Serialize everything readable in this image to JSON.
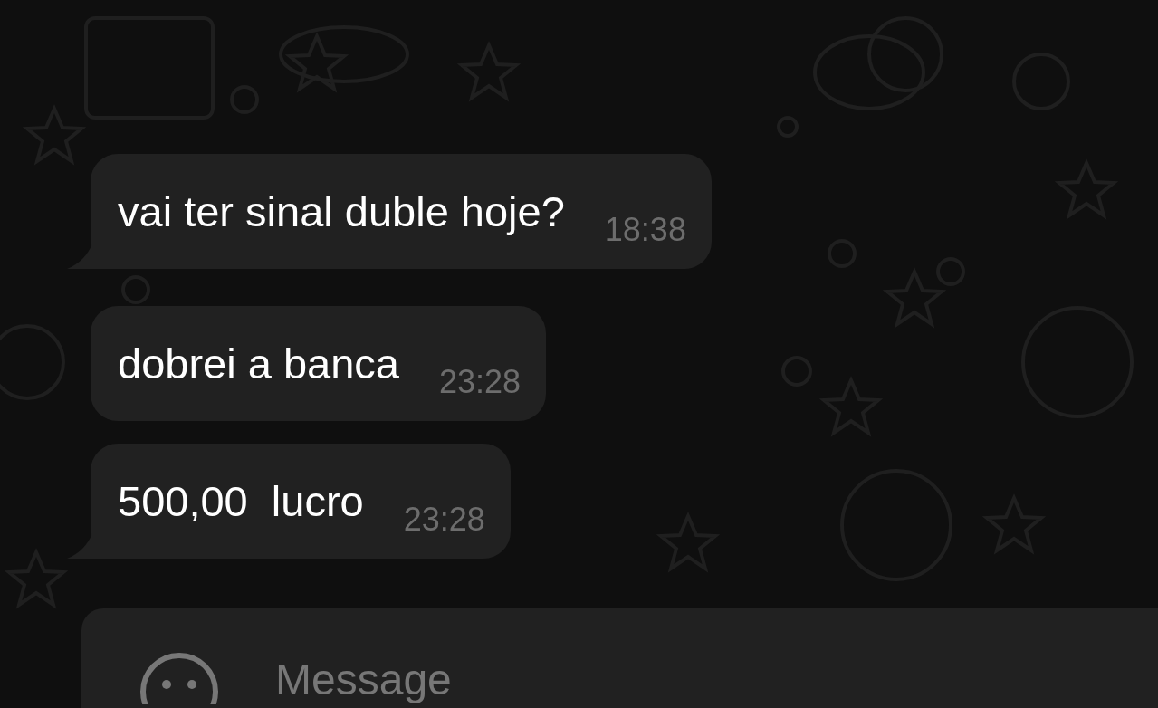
{
  "messages": [
    {
      "text": "vai ter sinal duble hoje?",
      "time": "18:38",
      "tail": true
    },
    {
      "text": "dobrei a banca",
      "time": "23:28",
      "tail": false
    },
    {
      "text": "500,00  lucro",
      "time": "23:28",
      "tail": true
    }
  ],
  "composer": {
    "placeholder": "Message"
  }
}
